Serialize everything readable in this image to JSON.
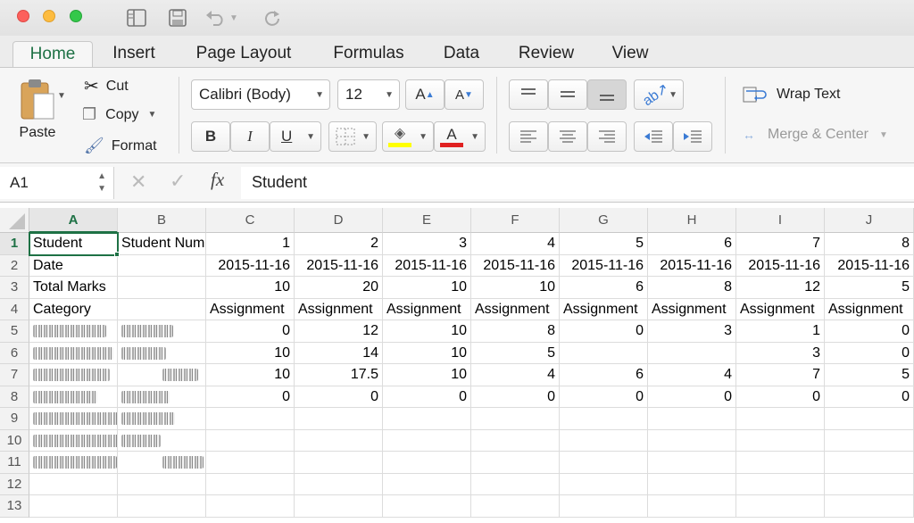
{
  "window": {
    "quick_access": {
      "sidebar_icon": "sidebar-icon",
      "save_icon": "save-icon",
      "undo_icon": "undo-icon",
      "redo_icon": "redo-icon"
    }
  },
  "tabs": [
    "Home",
    "Insert",
    "Page Layout",
    "Formulas",
    "Data",
    "Review",
    "View"
  ],
  "ribbon": {
    "paste_label": "Paste",
    "cut_label": "Cut",
    "copy_label": "Copy",
    "format_label": "Format",
    "font_name": "Calibri (Body)",
    "font_size": "12",
    "increase_font": "A",
    "decrease_font": "A",
    "bold": "B",
    "italic": "I",
    "underline": "U",
    "font_color_letter": "A",
    "wrap_text_label": "Wrap Text",
    "merge_center_label": "Merge & Center",
    "accent_color": "#1e7145",
    "highlight_color": "#ffff00",
    "font_color": "#e02020"
  },
  "formula_bar": {
    "name_box": "A1",
    "fx": "fx",
    "value": "Student"
  },
  "sheet": {
    "columns": [
      "A",
      "B",
      "C",
      "D",
      "E",
      "F",
      "G",
      "H",
      "I",
      "J"
    ],
    "rows": [
      "1",
      "2",
      "3",
      "4",
      "5",
      "6",
      "7",
      "8",
      "9",
      "10",
      "11",
      "12",
      "13"
    ],
    "selected_cell": "A1",
    "row1": [
      "Student",
      "Student Num",
      "1",
      "2",
      "3",
      "4",
      "5",
      "6",
      "7",
      "8"
    ],
    "row2": [
      "Date",
      "",
      "2015-11-16",
      "2015-11-16",
      "2015-11-16",
      "2015-11-16",
      "2015-11-16",
      "2015-11-16",
      "2015-11-16",
      "2015-11-16"
    ],
    "row3": [
      "Total Marks",
      "",
      "10",
      "20",
      "10",
      "10",
      "6",
      "8",
      "12",
      "5"
    ],
    "row4": [
      "Category",
      "",
      "Assignment",
      "Assignment",
      "Assignment",
      "Assignment",
      "Assignment",
      "Assignment",
      "Assignment",
      "Assignment"
    ],
    "row5": [
      "",
      "",
      "0",
      "12",
      "10",
      "8",
      "0",
      "3",
      "1",
      "0"
    ],
    "row6": [
      "",
      "",
      "10",
      "14",
      "10",
      "5",
      "",
      "",
      "3",
      "0"
    ],
    "row7": [
      "",
      "",
      "10",
      "17.5",
      "10",
      "4",
      "6",
      "4",
      "7",
      "5"
    ],
    "row8": [
      "",
      "",
      "0",
      "0",
      "0",
      "0",
      "0",
      "0",
      "0",
      "0"
    ]
  }
}
